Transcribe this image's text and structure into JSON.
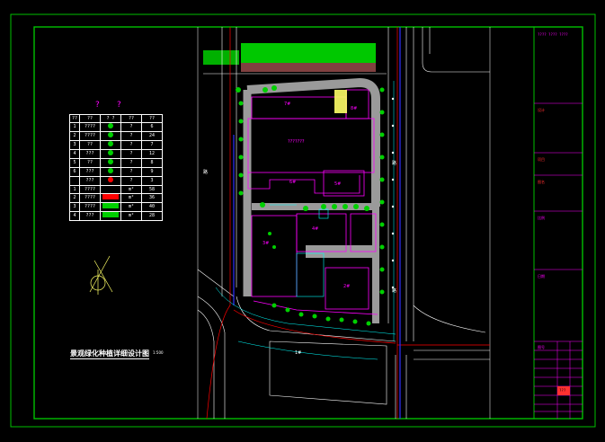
{
  "drawing": {
    "title": "景观绿化种植详细设计图",
    "scale": "1:500",
    "colors": {
      "background": "#000000",
      "frame": "#00c000",
      "road": "#ffffff",
      "building": "#ff00ff",
      "paving": "#9a9a9a",
      "tree": "#00d000",
      "water_line": "#00ffff",
      "red_line": "#ff0000",
      "blue_line": "#3030ff"
    }
  },
  "legend": {
    "header_marks": [
      "?",
      "?"
    ],
    "columns": [
      "??",
      "??",
      "? ?",
      "??",
      "??"
    ],
    "rows": [
      {
        "no": "1",
        "name": "????",
        "symbol": "green-dot",
        "unit": "?",
        "qty": "6"
      },
      {
        "no": "2",
        "name": "????",
        "symbol": "green-dot",
        "unit": "?",
        "qty": "24"
      },
      {
        "no": "3",
        "name": "??",
        "symbol": "green-dot",
        "unit": "?",
        "qty": "7"
      },
      {
        "no": "4",
        "name": "???",
        "symbol": "green-dot",
        "unit": "?",
        "qty": "12"
      },
      {
        "no": "5",
        "name": "??",
        "symbol": "green-dot",
        "unit": "?",
        "qty": "8"
      },
      {
        "no": "6",
        "name": "???",
        "symbol": "green-dot",
        "unit": "?",
        "qty": "9"
      },
      {
        "no": "",
        "name": "???",
        "symbol": "red-dot",
        "unit": "?",
        "qty": "3"
      },
      {
        "no": "1",
        "name": "????",
        "symbol": "none",
        "unit": "m²",
        "qty": "58"
      },
      {
        "no": "2",
        "name": "????",
        "symbol": "red-box",
        "unit": "m²",
        "qty": "36"
      },
      {
        "no": "3",
        "name": "????",
        "symbol": "green-box",
        "unit": "m²",
        "qty": "40"
      },
      {
        "no": "4",
        "name": "???",
        "symbol": "green-box",
        "unit": "m²",
        "qty": "28"
      }
    ]
  },
  "plan_labels": {
    "b1": "7#",
    "b2": "8#",
    "center": "???????",
    "b3": "6#",
    "b4": "5#",
    "b5": "3#",
    "b6": "4#",
    "b7": "2#",
    "b8": "1#",
    "road1": "路",
    "road2": "路",
    "road3": "路"
  },
  "title_block": {
    "lines": [
      "设计",
      "项目",
      "图名",
      "比例",
      "日期",
      "图号"
    ],
    "project": "???? ???? ????",
    "drawing_no": "???"
  }
}
